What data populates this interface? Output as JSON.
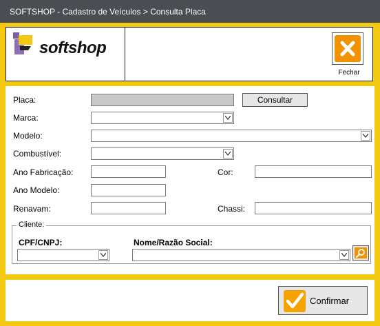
{
  "window": {
    "title": "SOFTSHOP - Cadastro de Veículos > Consulta Placa"
  },
  "header": {
    "logo_text": "softshop",
    "close_label": "Fechar"
  },
  "form": {
    "placa": {
      "label": "Placa:",
      "value": ""
    },
    "consultar_label": "Consultar",
    "marca": {
      "label": "Marca:",
      "value": ""
    },
    "modelo": {
      "label": "Modelo:",
      "value": ""
    },
    "combustivel": {
      "label": "Combustível:",
      "value": ""
    },
    "ano_fabricacao": {
      "label": "Ano Fabricação:",
      "value": ""
    },
    "cor": {
      "label": "Cor:",
      "value": ""
    },
    "ano_modelo": {
      "label": "Ano Modelo:",
      "value": ""
    },
    "renavam": {
      "label": "Renavam:",
      "value": ""
    },
    "chassi": {
      "label": "Chassi:",
      "value": ""
    }
  },
  "cliente": {
    "group_label": "Cliente:",
    "cpf_label": "CPF/CNPJ:",
    "cpf_value": "",
    "nome_label": "Nome/Razão Social:",
    "nome_value": ""
  },
  "footer": {
    "confirm_label": "Confirmar"
  },
  "colors": {
    "accent": "#f2c811",
    "button_orange": "#f39200",
    "titlebar": "#4a4d51"
  }
}
